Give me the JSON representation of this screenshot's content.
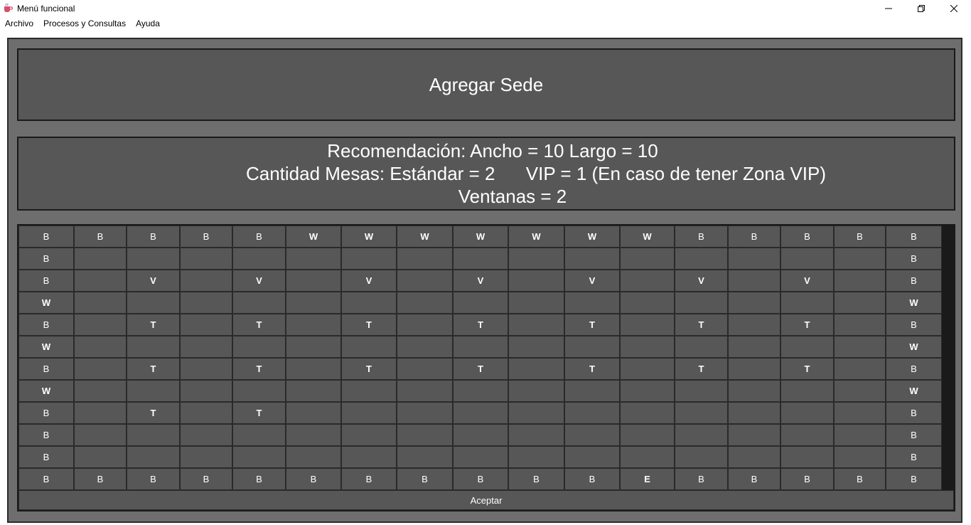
{
  "window": {
    "title": "Menú funcional",
    "icon": "coffee-cup-icon"
  },
  "menubar": {
    "items": [
      "Archivo",
      "Procesos y Consultas",
      "Ayuda"
    ]
  },
  "header": {
    "title": "Agregar Sede"
  },
  "info": {
    "line1": "Recomendación: Ancho = 10 Largo = 10",
    "line2": "Cantidad Mesas: Estándar = 2      VIP = 1 (En caso de tener Zona VIP)",
    "line3": "Ventanas = 2"
  },
  "grid": {
    "columns": 17,
    "rows": [
      [
        "B",
        "B",
        "B",
        "B",
        "B",
        "W",
        "W",
        "W",
        "W",
        "W",
        "W",
        "W",
        "B",
        "B",
        "B",
        "B",
        "B"
      ],
      [
        "B",
        "",
        "",
        "",
        "",
        "",
        "",
        "",
        "",
        "",
        "",
        "",
        "",
        "",
        "",
        "",
        "B"
      ],
      [
        "B",
        "",
        "V",
        "",
        "V",
        "",
        "V",
        "",
        "V",
        "",
        "V",
        "",
        "V",
        "",
        "V",
        "",
        "B"
      ],
      [
        "W",
        "",
        "",
        "",
        "",
        "",
        "",
        "",
        "",
        "",
        "",
        "",
        "",
        "",
        "",
        "",
        "W"
      ],
      [
        "B",
        "",
        "T",
        "",
        "T",
        "",
        "T",
        "",
        "T",
        "",
        "T",
        "",
        "T",
        "",
        "T",
        "",
        "B"
      ],
      [
        "W",
        "",
        "",
        "",
        "",
        "",
        "",
        "",
        "",
        "",
        "",
        "",
        "",
        "",
        "",
        "",
        "W"
      ],
      [
        "B",
        "",
        "T",
        "",
        "T",
        "",
        "T",
        "",
        "T",
        "",
        "T",
        "",
        "T",
        "",
        "T",
        "",
        "B"
      ],
      [
        "W",
        "",
        "",
        "",
        "",
        "",
        "",
        "",
        "",
        "",
        "",
        "",
        "",
        "",
        "",
        "",
        "W"
      ],
      [
        "B",
        "",
        "T",
        "",
        "T",
        "",
        "",
        "",
        "",
        "",
        "",
        "",
        "",
        "",
        "",
        "",
        "B"
      ],
      [
        "B",
        "",
        "",
        "",
        "",
        "",
        "",
        "",
        "",
        "",
        "",
        "",
        "",
        "",
        "",
        "",
        "B"
      ],
      [
        "B",
        "",
        "",
        "",
        "",
        "",
        "",
        "",
        "",
        "",
        "",
        "",
        "",
        "",
        "",
        "",
        "B"
      ],
      [
        "B",
        "B",
        "B",
        "B",
        "B",
        "B",
        "B",
        "B",
        "B",
        "B",
        "B",
        "E",
        "B",
        "B",
        "B",
        "B",
        "B"
      ]
    ]
  },
  "accept_button": {
    "label": "Aceptar"
  },
  "colors": {
    "panel_bg": "#6e6e6e",
    "box_bg": "#575757",
    "border": "#1a1a1a",
    "text": "#ffffff"
  }
}
